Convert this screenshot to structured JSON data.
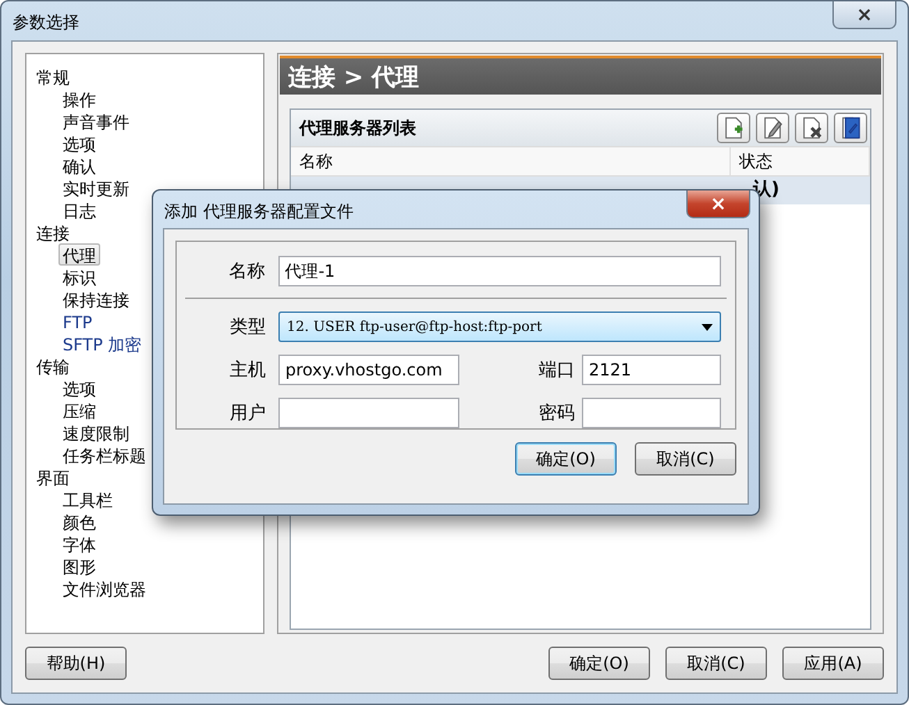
{
  "window": {
    "title": "参数选择",
    "close": "×"
  },
  "sidebar": {
    "items": [
      {
        "label": "常规",
        "selected": false,
        "children": [
          {
            "label": "操作",
            "selected": false
          },
          {
            "label": "声音事件",
            "selected": false
          },
          {
            "label": "选项",
            "selected": false
          },
          {
            "label": "确认",
            "selected": false
          },
          {
            "label": "实时更新",
            "selected": false
          },
          {
            "label": "日志",
            "selected": false
          }
        ]
      },
      {
        "label": "连接",
        "selected": false,
        "children": [
          {
            "label": "代理",
            "selected": true
          },
          {
            "label": "标识",
            "selected": false
          },
          {
            "label": "保持连接",
            "selected": false
          },
          {
            "label": "FTP",
            "selected": false,
            "color": "#1c3a8c"
          },
          {
            "label": "SFTP 加密",
            "selected": false,
            "color": "#1c3a8c"
          }
        ]
      },
      {
        "label": "传输",
        "selected": false,
        "children": [
          {
            "label": "选项",
            "selected": false
          },
          {
            "label": "压缩",
            "selected": false
          },
          {
            "label": "速度限制",
            "selected": false
          },
          {
            "label": "任务栏标题",
            "selected": false
          }
        ]
      },
      {
        "label": "界面",
        "selected": false,
        "children": [
          {
            "label": "工具栏",
            "selected": false
          },
          {
            "label": "颜色",
            "selected": false
          },
          {
            "label": "字体",
            "selected": false
          },
          {
            "label": "图形",
            "selected": false
          },
          {
            "label": "文件浏览器",
            "selected": false
          }
        ]
      }
    ]
  },
  "panel": {
    "title": "连接 > 代理",
    "list_title": "代理服务器列表",
    "toolbar": [
      {
        "kind": "add"
      },
      {
        "kind": "edit"
      },
      {
        "kind": "delete"
      },
      {
        "kind": "test"
      }
    ],
    "columns": [
      "名称",
      "状态"
    ],
    "rows": [
      {
        "status": "认)",
        "selected": true
      }
    ]
  },
  "dialog": {
    "title": "添加 代理服务器配置文件",
    "close": "×",
    "name": {
      "label": "名称",
      "value": "代理-1"
    },
    "type": {
      "label": "类型",
      "value": "12. USER ftp-user@ftp-host:ftp-port"
    },
    "host": {
      "label": "主机",
      "value": "proxy.vhostgo.com"
    },
    "port": {
      "label": "端口",
      "value": "2121"
    },
    "user": {
      "label": "用户"
    },
    "password": {
      "label": "密码"
    },
    "buttons": [
      {
        "label": "确定(O)",
        "default": true
      },
      {
        "label": "取消(C)",
        "default": false
      }
    ]
  },
  "buttons": {
    "help": "帮助(H)",
    "actions": [
      "确定(O)",
      "取消(C)",
      "应用(A)"
    ]
  }
}
